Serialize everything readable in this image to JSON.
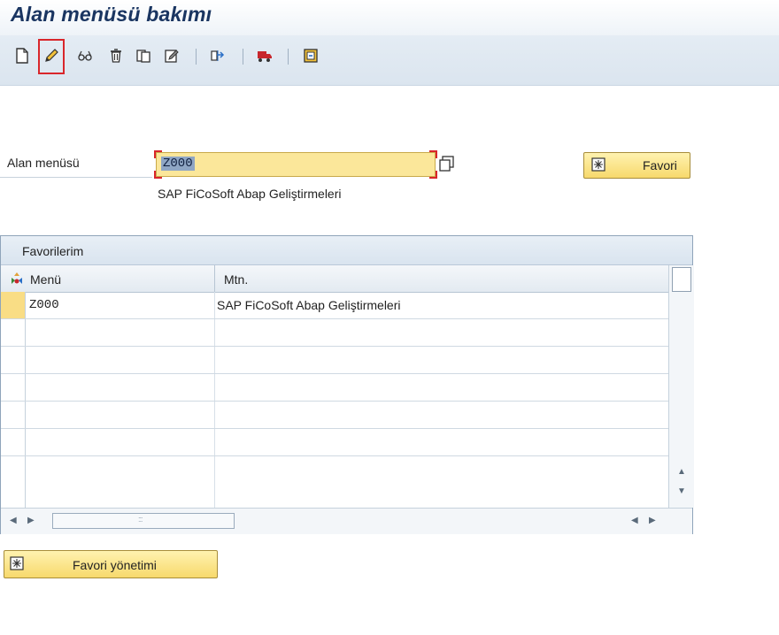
{
  "window": {
    "title": "Alan menüsü bakımı"
  },
  "toolbar": {
    "buttons": [
      {
        "icon": "new-document-icon"
      },
      {
        "icon": "pencil-edit-icon",
        "highlighted": true
      },
      {
        "icon": "glasses-display-icon"
      },
      {
        "icon": "trash-delete-icon"
      },
      {
        "icon": "copy-icon"
      },
      {
        "icon": "rename-icon"
      },
      {
        "icon": "hierarchy-arrows-icon"
      },
      {
        "icon": "truck-transport-icon"
      },
      {
        "icon": "save-layout-icon"
      }
    ]
  },
  "form": {
    "area_menu_label": "Alan menüsü",
    "area_menu_value": "Z000",
    "area_menu_description": "SAP FiCoSoft Abap Geliştirmeleri",
    "favorite_button": "Favori"
  },
  "favorites_table": {
    "title": "Favorilerim",
    "columns": [
      "Menü",
      "Mtn."
    ],
    "rows": [
      {
        "menu": "Z000",
        "text": "SAP FiCoSoft Abap Geliştirmeleri"
      },
      {
        "menu": "",
        "text": ""
      },
      {
        "menu": "",
        "text": ""
      },
      {
        "menu": "",
        "text": ""
      },
      {
        "menu": "",
        "text": ""
      },
      {
        "menu": "",
        "text": ""
      },
      {
        "menu": "",
        "text": ""
      }
    ]
  },
  "manage_favorites_button": "Favori yönetimi",
  "colors": {
    "input_bg": "#fbe79a",
    "highlight": "#d9262b",
    "title": "#1a3561"
  }
}
